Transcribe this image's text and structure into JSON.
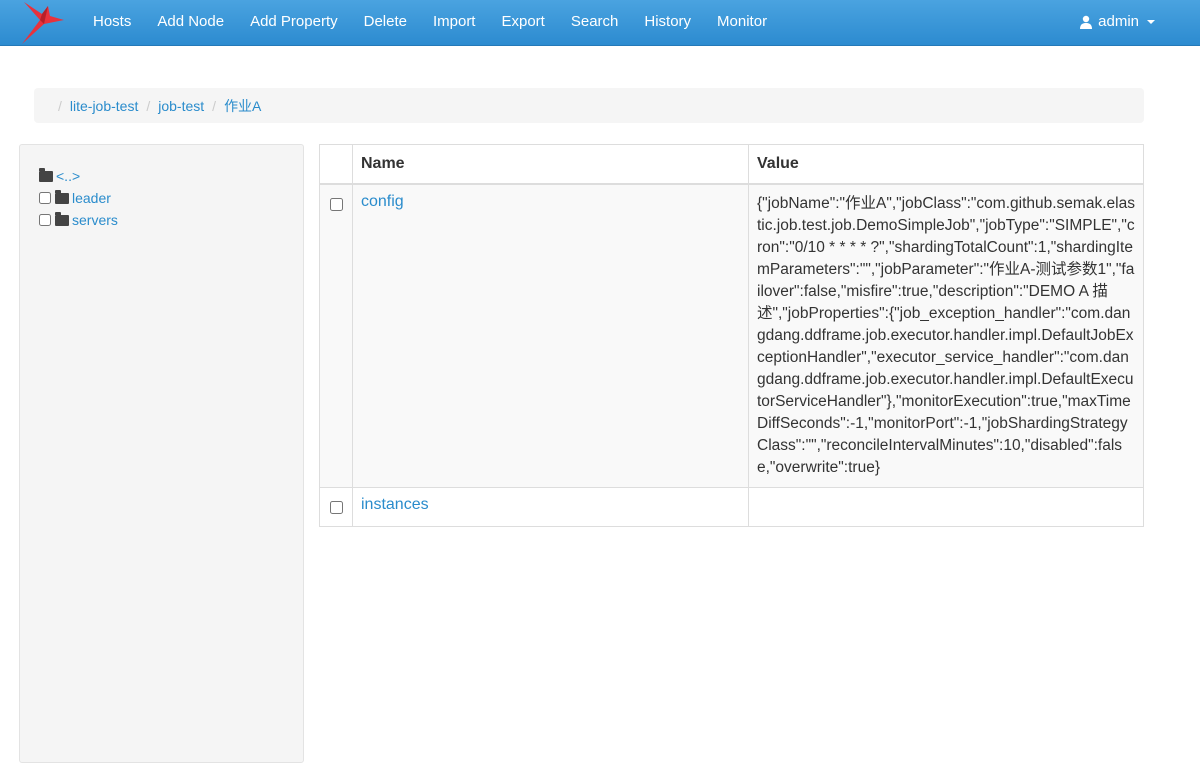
{
  "nav": {
    "items": [
      "Hosts",
      "Add Node",
      "Add Property",
      "Delete",
      "Import",
      "Export",
      "Search",
      "History",
      "Monitor"
    ],
    "user": "admin",
    "brand_icon": "bird-logo-icon",
    "accent": "#3a98d8"
  },
  "breadcrumb": [
    "lite-job-test",
    "job-test",
    "作业A"
  ],
  "tree": {
    "parent_label": "<..>",
    "items": [
      "leader",
      "servers"
    ]
  },
  "table": {
    "headers": {
      "name": "Name",
      "value": "Value"
    },
    "rows": [
      {
        "name": "config",
        "value": "{\"jobName\":\"作业A\",\"jobClass\":\"com.github.semak.elastic.job.test.job.DemoSimpleJob\",\"jobType\":\"SIMPLE\",\"cron\":\"0/10 * * * * ?\",\"shardingTotalCount\":1,\"shardingItemParameters\":\"\",\"jobParameter\":\"作业A-测试参数1\",\"failover\":false,\"misfire\":true,\"description\":\"DEMO A 描述\",\"jobProperties\":{\"job_exception_handler\":\"com.dangdang.ddframe.job.executor.handler.impl.DefaultJobExceptionHandler\",\"executor_service_handler\":\"com.dangdang.ddframe.job.executor.handler.impl.DefaultExecutorServiceHandler\"},\"monitorExecution\":true,\"maxTimeDiffSeconds\":-1,\"monitorPort\":-1,\"jobShardingStrategyClass\":\"\",\"reconcileIntervalMinutes\":10,\"disabled\":false,\"overwrite\":true}"
      },
      {
        "name": "instances",
        "value": ""
      }
    ]
  }
}
